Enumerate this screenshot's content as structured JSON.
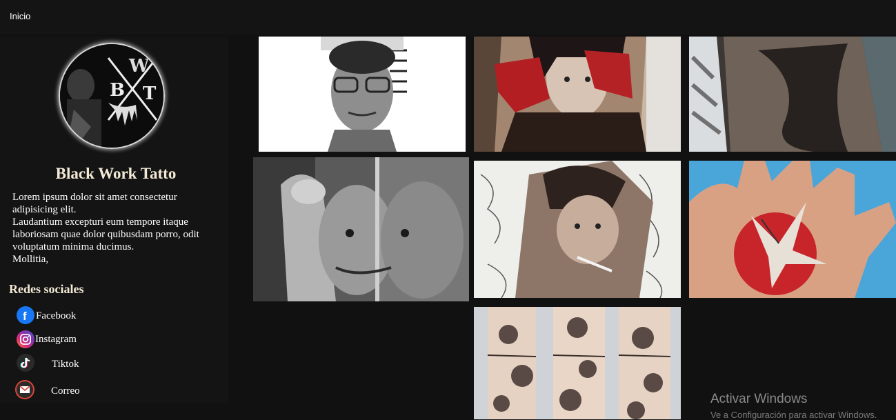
{
  "nav": {
    "home_label": "Inicio"
  },
  "profile": {
    "title": "Black Work Tatto",
    "bio_lines": [
      "Lorem ipsum dolor sit amet consectetur",
      "adipisicing elit.",
      "Laudantium excepturi eum tempore itaque",
      "laboriosam quae dolor quibusdam porro, odit",
      "voluptatum minima ducimus.",
      "Mollitia,"
    ]
  },
  "social": {
    "title": "Redes sociales",
    "items": [
      {
        "label": "Facebook",
        "icon": "facebook-icon",
        "color": "#1877f2"
      },
      {
        "label": "Instagram",
        "icon": "instagram-icon",
        "color": "#c13584"
      },
      {
        "label": "Tiktok",
        "icon": "tiktok-icon",
        "color": "#222222"
      },
      {
        "label": "Correo",
        "icon": "mail-icon",
        "color": "#d94436"
      }
    ]
  },
  "gallery": {
    "images": [
      {
        "name": "mugshot-portrait-tattoo"
      },
      {
        "name": "oni-mask-girl-tattoo"
      },
      {
        "name": "dark-arm-tattoo"
      },
      {
        "name": "split-face-portrait-tattoo"
      },
      {
        "name": "anime-boy-smoking-tattoo"
      },
      {
        "name": "crane-sun-palm-tattoo"
      },
      {
        "name": "floral-leg-bands-tattoo"
      }
    ]
  },
  "watermark": {
    "title": "Activar Windows",
    "subtitle": "Ve a Configuración para activar Windows."
  }
}
